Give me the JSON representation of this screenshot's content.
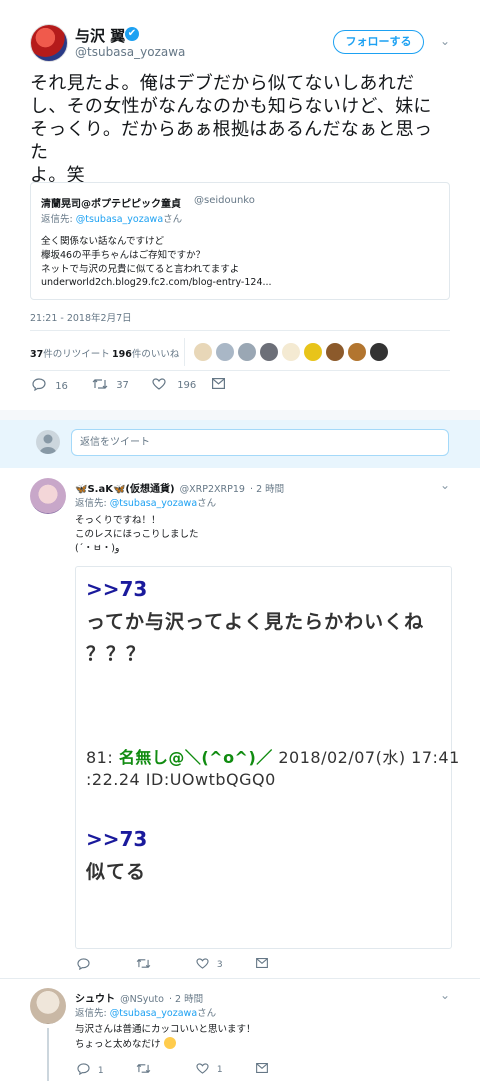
{
  "tweet": {
    "author_name": "与沢 翼",
    "verified_mark": "✔",
    "author_handle": "@tsubasa_yozawa",
    "follow_label": "フォローする",
    "text_lines": [
      "それ見たよ。俺はデブだから似てないしあれだ",
      "し、その女性がなんなのかも知らないけど、妹に",
      "そっくり。だからあぁ根拠はあるんだなぁと思った",
      "よ。笑"
    ],
    "quote": {
      "name": "清蘭晃司@ポプテピピック童貞",
      "handle": "@seidounko",
      "reply_prefix": "返信先: ",
      "reply_handle": "@tsubasa_yozawa",
      "reply_suffix": "さん",
      "lines": [
        "全く関係ない話なんですけど",
        "欅坂46の平手ちゃんはご存知ですか？",
        "ネットで与沢の兄貴に似てると言われてますよ",
        "underworld2ch.blog29.fc2.com/blog-entry-124..."
      ]
    },
    "timestamp": "21:21 - 2018年2月7日",
    "retweets_count": "37",
    "retweets_label": "件のリツイート",
    "likes_count": "196",
    "likes_label": "件のいいね",
    "actions": {
      "reply": "16",
      "retweet": "37",
      "like": "196"
    }
  },
  "reply_box": {
    "placeholder": "返信をツイート"
  },
  "replies": [
    {
      "name": "🦋S.aK🦋(仮想通貨)",
      "handle": "@XRP2XRP19",
      "time": "· 2 時間",
      "reply_prefix": "返信先: ",
      "reply_handle": "@tsubasa_yozawa",
      "reply_suffix": "さん",
      "lines": [
        "そっくりですね！！",
        "このレスにほっこりしました",
        "(´・ㅂ・)و"
      ],
      "card": {
        "ref1": ">>73",
        "big_line1": "ってか与沢ってよく見たらかわいくね",
        "big_line2": "？？？",
        "meta_num": "81: ",
        "meta_name": "名無し@＼(^o^)／",
        "meta_date": " 2018/02/07(水) 17:41",
        "meta_line2": ":22.24 ID:UOwtbQGQ0",
        "ref2": ">>73",
        "big_line3": "似てる"
      },
      "actions": {
        "reply": "",
        "retweet": "",
        "like": "3"
      }
    },
    {
      "name": "シュウト",
      "handle": "@NSyuto",
      "time": "· 2 時間",
      "reply_prefix": "返信先: ",
      "reply_handle": "@tsubasa_yozawa",
      "reply_suffix": "さん",
      "lines": [
        "与沢さんは普通にカッコいいと思います！",
        "ちょっと太めなだけ"
      ],
      "actions": {
        "reply": "1",
        "retweet": "",
        "like": "1"
      }
    }
  ],
  "colors": {
    "accent": "#1da1f2",
    "muted": "#657786",
    "border": "#e1e8ed"
  }
}
